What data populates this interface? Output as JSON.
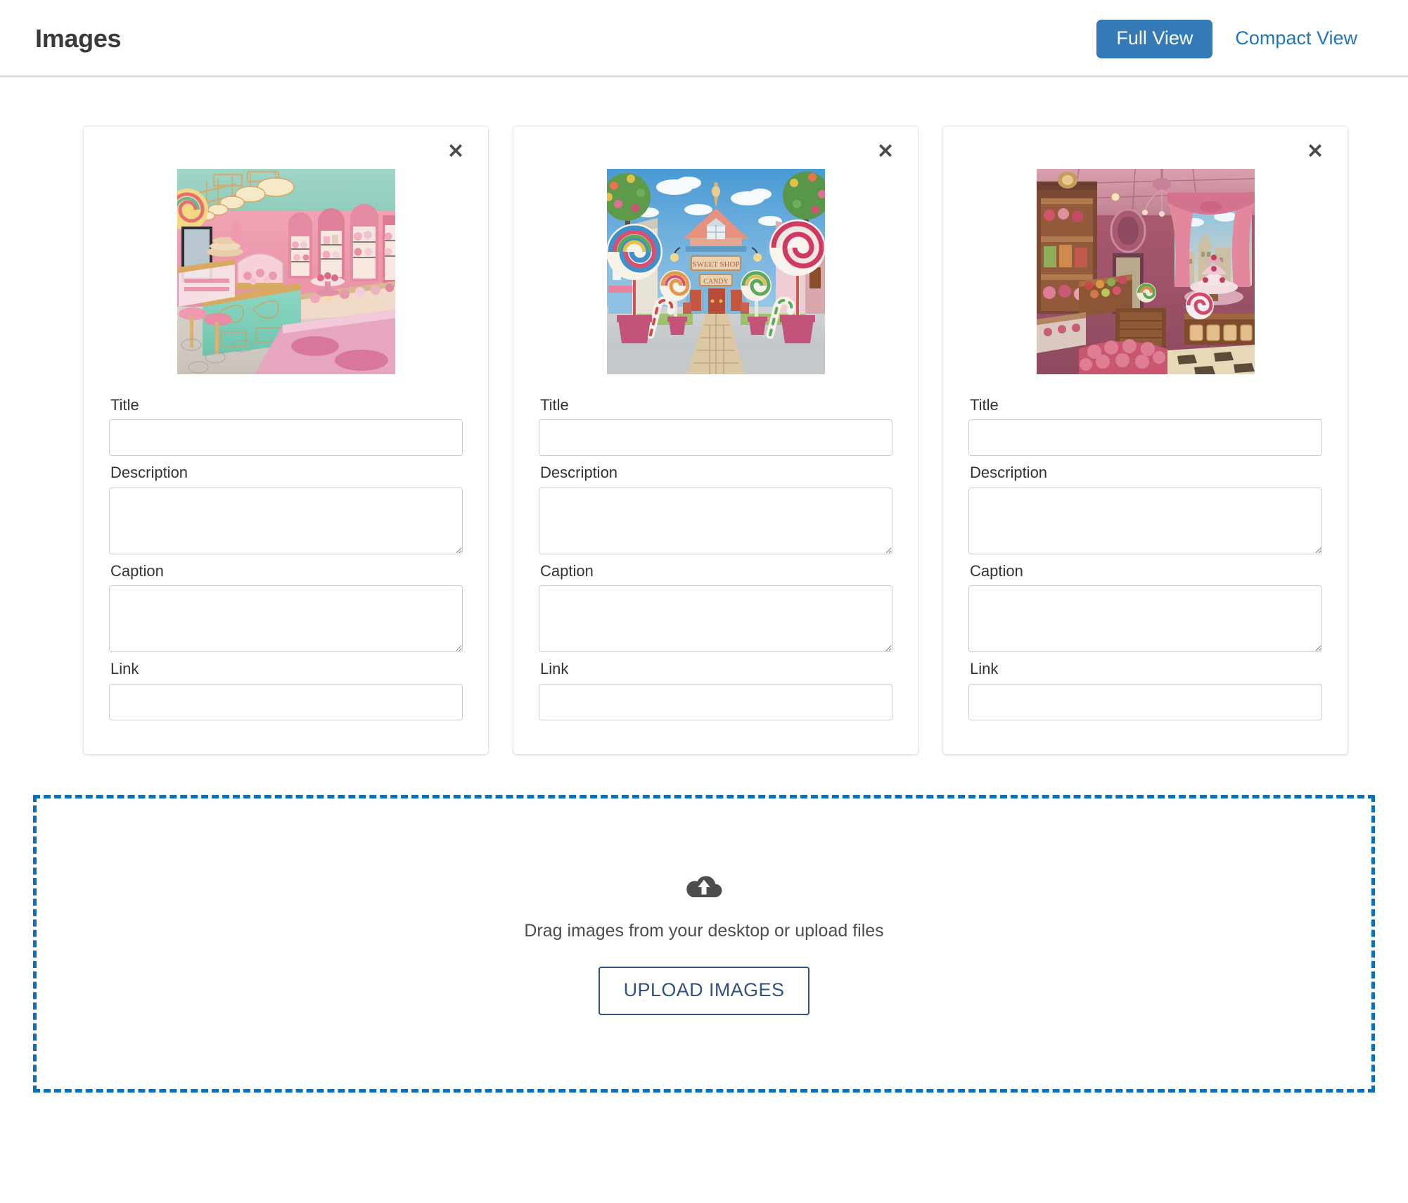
{
  "header": {
    "title": "Images",
    "view_buttons": [
      {
        "label": "Full View",
        "active": true,
        "name": "full-view-button"
      },
      {
        "label": "Compact View",
        "active": false,
        "name": "compact-view-button"
      }
    ],
    "accent_color": "#337ab7",
    "link_color": "#2077b8"
  },
  "fields": {
    "title_label": "Title",
    "description_label": "Description",
    "caption_label": "Caption",
    "link_label": "Link",
    "title_value": "",
    "description_value": "",
    "caption_value": "",
    "link_value": ""
  },
  "cards": [
    {
      "close_icon": "close-icon",
      "image_alt": "Pink and mint pastel candy shop interior with hanging lamps, arched display shelves and pink stools",
      "title": "",
      "description": "",
      "caption": "",
      "link": ""
    },
    {
      "close_icon": "close-icon",
      "image_alt": "Candy land street scene with a blue Victorian candy store, giant lollipops in pink pots and a cobblestone path",
      "title": "",
      "description": "",
      "caption": "",
      "link": ""
    },
    {
      "close_icon": "close-icon",
      "image_alt": "Ornate crimson and pink Victorian confectionery interior with draped curtains, a tiered cake and checkered floor",
      "title": "",
      "description": "",
      "caption": "",
      "link": ""
    }
  ],
  "dropzone": {
    "icon": "cloud-upload-icon",
    "text": "Drag images from your desktop or upload files",
    "button_label": "UPLOAD IMAGES",
    "border_color": "#0d70b6",
    "button_color": "#33527d"
  }
}
